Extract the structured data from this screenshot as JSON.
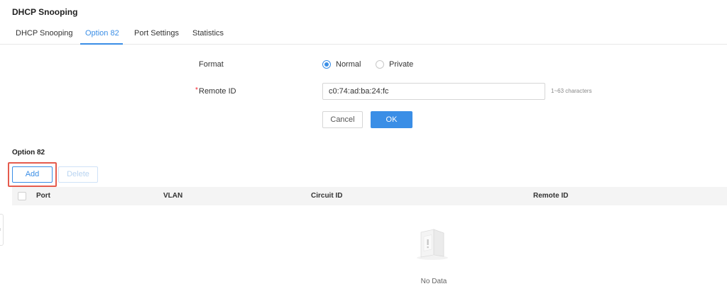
{
  "page_title": "DHCP Snooping",
  "tabs": [
    {
      "label": "DHCP Snooping",
      "active": false
    },
    {
      "label": "Option 82",
      "active": true
    },
    {
      "label": "Port Settings",
      "active": false
    },
    {
      "label": "Statistics",
      "active": false
    }
  ],
  "form": {
    "format_label": "Format",
    "format_options": [
      {
        "label": "Normal",
        "checked": true
      },
      {
        "label": "Private",
        "checked": false
      }
    ],
    "remote_id_label": "Remote ID",
    "remote_id_required": true,
    "remote_id_value": "c0:74:ad:ba:24:fc",
    "remote_id_hint": "1~63 characters",
    "cancel_label": "Cancel",
    "ok_label": "OK"
  },
  "section": {
    "title": "Option 82",
    "add_label": "Add",
    "delete_label": "Delete"
  },
  "table": {
    "columns": [
      "Port",
      "VLAN",
      "Circuit ID",
      "Remote ID"
    ],
    "rows": [],
    "empty_text": "No Data"
  },
  "colors": {
    "accent": "#3a8ee6",
    "highlight": "#e55b4d",
    "required": "#f5222d"
  }
}
